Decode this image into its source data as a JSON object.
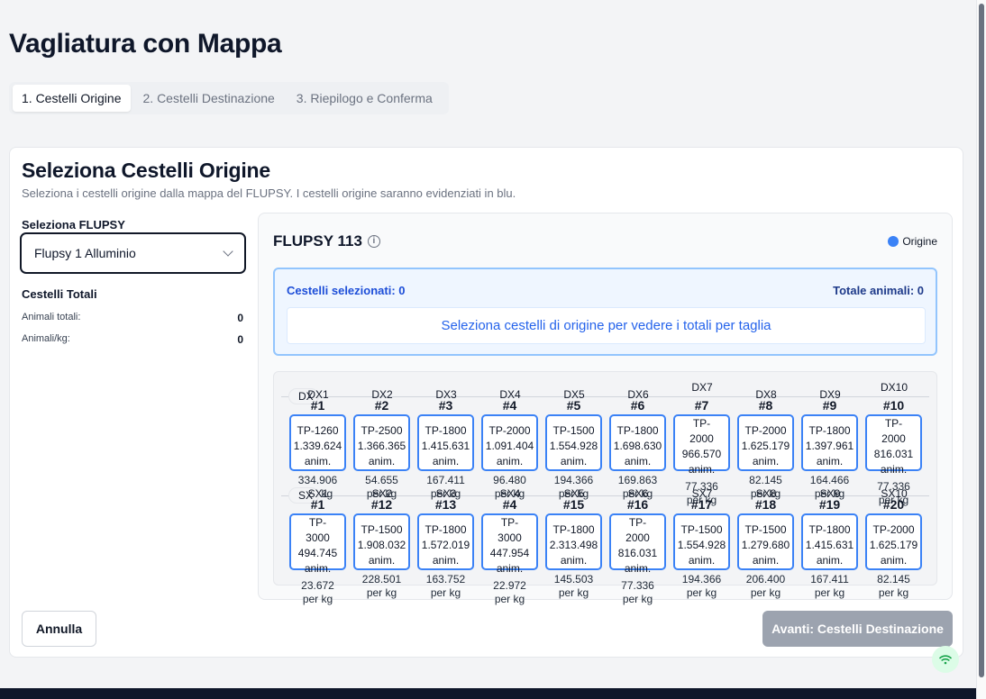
{
  "page": {
    "title": "Vagliatura con Mappa"
  },
  "tabs": [
    {
      "label": "1. Cestelli Origine",
      "active": true
    },
    {
      "label": "2. Cestelli Destinazione",
      "active": false
    },
    {
      "label": "3. Riepilogo e Conferma",
      "active": false
    }
  ],
  "card": {
    "title": "Seleziona Cestelli Origine",
    "subtitle": "Seleziona i cestelli origine dalla mappa del FLUPSY. I cestelli origine saranno evidenziati in blu."
  },
  "flupsy_select": {
    "label": "Seleziona FLUPSY",
    "value": "Flupsy 1 Alluminio"
  },
  "totals": {
    "title": "Cestelli Totali",
    "animals_label": "Animali totali:",
    "animals_value": "0",
    "per_kg_label": "Animali/kg:",
    "per_kg_value": "0"
  },
  "map": {
    "title": "FLUPSY 113",
    "legend_label": "Origine",
    "legend_color": "#3b82f6",
    "selected_label": "Cestelli selezionati: 0",
    "total_animals_label": "Totale animali: 0",
    "hint": "Seleziona cestelli di origine per vedere i totali per taglia",
    "rows": [
      {
        "chip": "DX",
        "baskets": [
          {
            "pos": "DX1",
            "num": "#1",
            "lines": [
              "TP-1260",
              "1.339.624",
              "anim."
            ],
            "kg": [
              "334.906",
              "per kg"
            ]
          },
          {
            "pos": "DX2",
            "num": "#2",
            "lines": [
              "TP-2500",
              "1.366.365",
              "anim."
            ],
            "kg": [
              "54.655",
              "per kg"
            ]
          },
          {
            "pos": "DX3",
            "num": "#3",
            "lines": [
              "TP-1800",
              "1.415.631",
              "anim."
            ],
            "kg": [
              "167.411",
              "per kg"
            ]
          },
          {
            "pos": "DX4",
            "num": "#4",
            "lines": [
              "TP-2000",
              "1.091.404",
              "anim."
            ],
            "kg": [
              "96.480",
              "per kg"
            ]
          },
          {
            "pos": "DX5",
            "num": "#5",
            "lines": [
              "TP-1500",
              "1.554.928",
              "anim."
            ],
            "kg": [
              "194.366",
              "per kg"
            ]
          },
          {
            "pos": "DX6",
            "num": "#6",
            "lines": [
              "TP-1800",
              "1.698.630",
              "anim."
            ],
            "kg": [
              "169.863",
              "per kg"
            ]
          },
          {
            "pos": "DX7",
            "num": "#7",
            "lines": [
              "TP-",
              "2000",
              "966.570",
              "anim."
            ],
            "kg": [
              "77.336",
              "per kg"
            ]
          },
          {
            "pos": "DX8",
            "num": "#8",
            "lines": [
              "TP-2000",
              "1.625.179",
              "anim."
            ],
            "kg": [
              "82.145",
              "per kg"
            ]
          },
          {
            "pos": "DX9",
            "num": "#9",
            "lines": [
              "TP-1800",
              "1.397.961",
              "anim."
            ],
            "kg": [
              "164.466",
              "per kg"
            ]
          },
          {
            "pos": "DX10",
            "num": "#10",
            "lines": [
              "TP-",
              "2000",
              "816.031",
              "anim."
            ],
            "kg": [
              "77.336",
              "per kg"
            ]
          }
        ]
      },
      {
        "chip": "SX",
        "baskets": [
          {
            "pos": "SX1",
            "num": "#1",
            "lines": [
              "TP-",
              "3000",
              "494.745",
              "anim."
            ],
            "kg": [
              "23.672",
              "per kg"
            ]
          },
          {
            "pos": "SX2",
            "num": "#12",
            "lines": [
              "TP-1500",
              "1.908.032",
              "anim."
            ],
            "kg": [
              "228.501",
              "per kg"
            ]
          },
          {
            "pos": "SX3",
            "num": "#13",
            "lines": [
              "TP-1800",
              "1.572.019",
              "anim."
            ],
            "kg": [
              "163.752",
              "per kg"
            ]
          },
          {
            "pos": "SX4",
            "num": "#4",
            "lines": [
              "TP-",
              "3000",
              "447.954",
              "anim."
            ],
            "kg": [
              "22.972",
              "per kg"
            ]
          },
          {
            "pos": "SX5",
            "num": "#15",
            "lines": [
              "TP-1800",
              "2.313.498",
              "anim."
            ],
            "kg": [
              "145.503",
              "per kg"
            ]
          },
          {
            "pos": "SX6",
            "num": "#16",
            "lines": [
              "TP-",
              "2000",
              "816.031",
              "anim."
            ],
            "kg": [
              "77.336",
              "per kg"
            ]
          },
          {
            "pos": "SX7",
            "num": "#17",
            "lines": [
              "TP-1500",
              "1.554.928",
              "anim."
            ],
            "kg": [
              "194.366",
              "per kg"
            ]
          },
          {
            "pos": "SX8",
            "num": "#18",
            "lines": [
              "TP-1500",
              "1.279.680",
              "anim."
            ],
            "kg": [
              "206.400",
              "per kg"
            ]
          },
          {
            "pos": "SX9",
            "num": "#19",
            "lines": [
              "TP-1800",
              "1.415.631",
              "anim."
            ],
            "kg": [
              "167.411",
              "per kg"
            ]
          },
          {
            "pos": "SX10",
            "num": "#20",
            "lines": [
              "TP-2000",
              "1.625.179",
              "anim."
            ],
            "kg": [
              "82.145",
              "per kg"
            ]
          }
        ]
      }
    ]
  },
  "buttons": {
    "cancel": "Annulla",
    "next": "Avanti: Cestelli Destinazione"
  }
}
